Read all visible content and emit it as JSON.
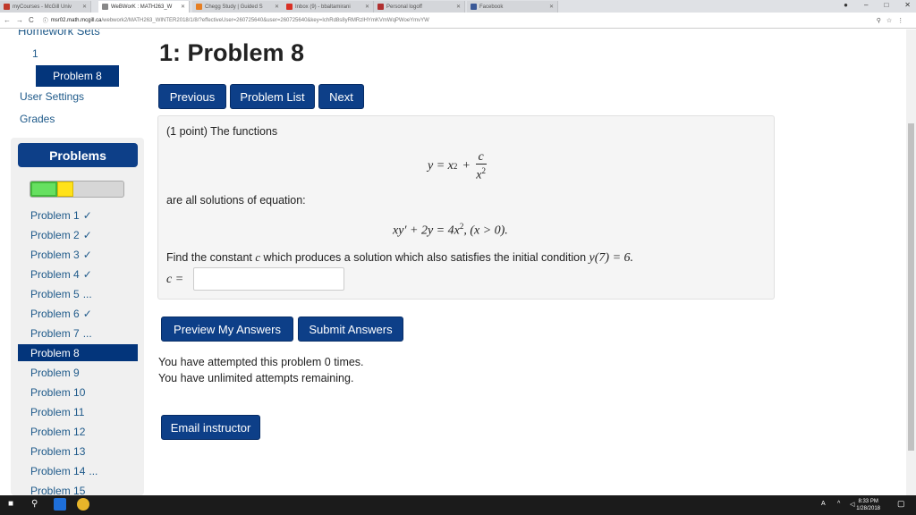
{
  "browser": {
    "tabs": [
      {
        "label": "myCourses - McGill Univ",
        "icon_color": "#c0392b",
        "active": false
      },
      {
        "label": "WeBWorK : MATH263_W",
        "icon_color": "#888888",
        "active": true
      },
      {
        "label": "Chegg Study | Guided S",
        "icon_color": "#e67e22",
        "active": false
      },
      {
        "label": "Inbox (9) - bbaltamirani",
        "icon_color": "#d93025",
        "active": false
      },
      {
        "label": "Personal logoff",
        "icon_color": "#b03030",
        "active": false
      },
      {
        "label": "Facebook",
        "icon_color": "#3b5998",
        "active": false
      }
    ],
    "url_host": "msr02.math.mcgill.ca",
    "url_path": "/webwork2/MATH263_WINTER2018/1/8/?effectiveUser=260725640&user=260725640&key=IchRd8s8yRMRzlHYmKVmWqPWoeYmvYW",
    "window_controls": [
      "–",
      "□",
      "✕"
    ],
    "profile_icon": "profile-icon"
  },
  "sidebar": {
    "homework_sets": "Homework Sets",
    "set_number": "1",
    "active_problem": "Problem 8",
    "user_settings": "User Settings",
    "grades": "Grades",
    "problems_header": "Problems",
    "problems": [
      {
        "label": "Problem 1",
        "status": "✓"
      },
      {
        "label": "Problem 2",
        "status": "✓"
      },
      {
        "label": "Problem 3",
        "status": "✓"
      },
      {
        "label": "Problem 4",
        "status": "✓"
      },
      {
        "label": "Problem 5",
        "status": "..."
      },
      {
        "label": "Problem 6",
        "status": "✓"
      },
      {
        "label": "Problem 7",
        "status": "..."
      },
      {
        "label": "Problem 8",
        "status": ""
      },
      {
        "label": "Problem 9",
        "status": ""
      },
      {
        "label": "Problem 10",
        "status": ""
      },
      {
        "label": "Problem 11",
        "status": ""
      },
      {
        "label": "Problem 12",
        "status": ""
      },
      {
        "label": "Problem 13",
        "status": ""
      },
      {
        "label": "Problem 14",
        "status": "..."
      },
      {
        "label": "Problem 15",
        "status": ""
      }
    ]
  },
  "main": {
    "title": "1: Problem 8",
    "nav_buttons": {
      "previous": "Previous",
      "problem_list": "Problem List",
      "next": "Next"
    },
    "problem": {
      "intro": "(1 point) The functions",
      "formula1": {
        "lhs": "y = x",
        "exp": "2",
        "plus": "+",
        "num": "c",
        "den_base": "x",
        "den_exp": "2"
      },
      "middle": "are all solutions of equation:",
      "formula2": {
        "part1": "xy′ + 2y = 4x",
        "exp": "2",
        "part2": ", (x > 0)."
      },
      "question_before": "Find the constant",
      "question_var": "c",
      "question_after": "which produces a solution which also satisfies the initial condition",
      "condition": "y(7) = 6.",
      "answer_label": "c =",
      "answer_value": ""
    },
    "actions": {
      "preview": "Preview My Answers",
      "submit": "Submit Answers"
    },
    "attempts_line1": "You have attempted this problem 0 times.",
    "attempts_line2": "You have unlimited attempts remaining.",
    "email_instructor": "Email instructor"
  },
  "taskbar": {
    "time": "8:33 PM",
    "date": "1/28/2018"
  }
}
